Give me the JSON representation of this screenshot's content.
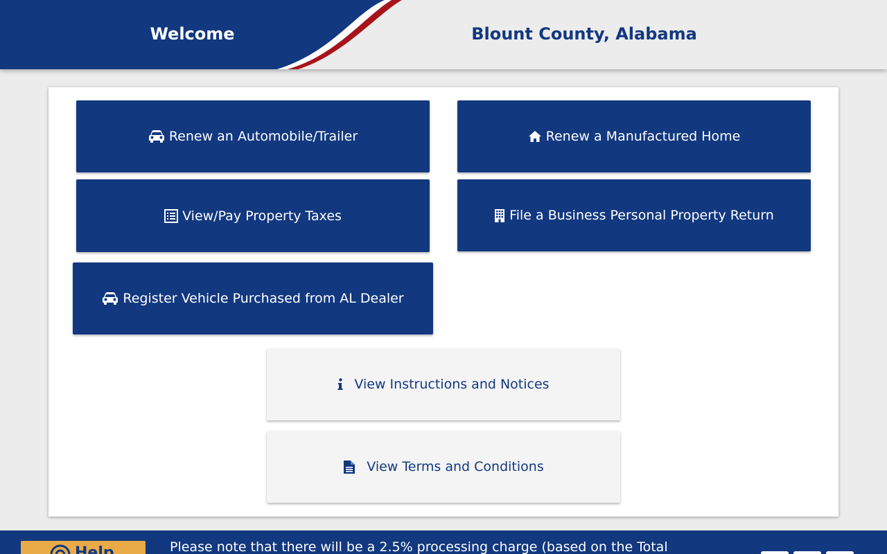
{
  "header": {
    "welcome": "Welcome",
    "county": "Blount County, Alabama"
  },
  "actions": {
    "renew_auto": {
      "label": "Renew an Automobile/Trailer",
      "icon": "car-icon"
    },
    "renew_home": {
      "label": "Renew a Manufactured Home",
      "icon": "home-icon"
    },
    "property_taxes": {
      "label": "View/Pay Property Taxes",
      "icon": "list-icon"
    },
    "business_property": {
      "label": "File a Business Personal Property Return",
      "icon": "building-icon"
    },
    "register_vehicle": {
      "label": "Register Vehicle Purchased from AL Dealer",
      "icon": "car-icon"
    },
    "instructions": {
      "label": "View Instructions and Notices",
      "icon": "info-icon"
    },
    "terms": {
      "label": "View Terms and Conditions",
      "icon": "document-icon"
    }
  },
  "footer": {
    "help_label": "Help",
    "notice": "Please note that there will be a 2.5% processing charge (based on the Total"
  },
  "colors": {
    "primary": "#12387f",
    "accent_red": "#a8141c",
    "help_bg": "#e8ab48",
    "background": "#ececec"
  }
}
